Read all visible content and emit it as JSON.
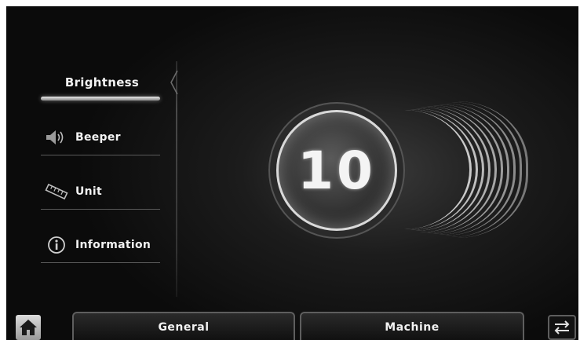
{
  "menu": {
    "items": [
      {
        "label": "Brightness",
        "icon": "none",
        "active": true
      },
      {
        "label": "Beeper",
        "icon": "speaker-icon",
        "active": false
      },
      {
        "label": "Unit",
        "icon": "ruler-icon",
        "active": false
      },
      {
        "label": "Information",
        "icon": "info-icon",
        "active": false
      }
    ]
  },
  "brightness": {
    "value": "10",
    "level": 10
  },
  "bottom_tabs": {
    "general_label": "General",
    "machine_label": "Machine"
  },
  "buttons": {
    "home_icon": "home-icon",
    "swap_icon": "swap-arrows-icon"
  },
  "colors": {
    "background": "#111111",
    "text": "#f2f2f2",
    "accent": "#e8e8e8"
  }
}
